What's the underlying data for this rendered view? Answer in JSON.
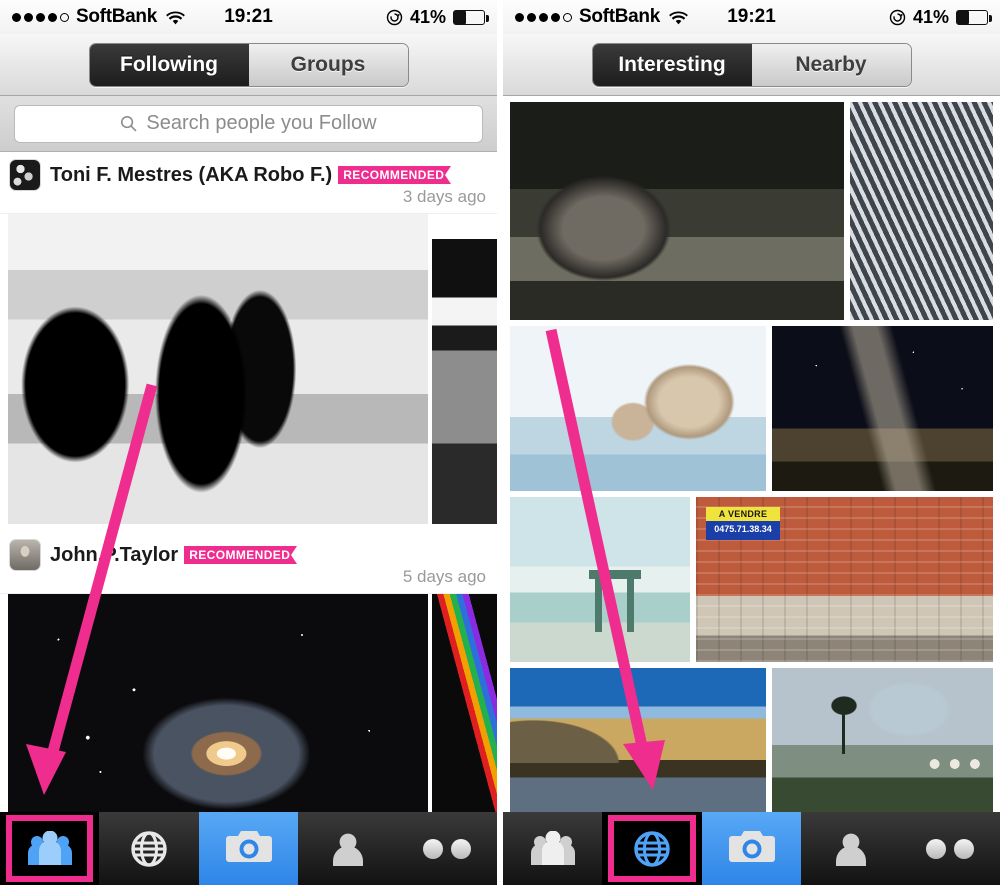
{
  "status_bar": {
    "signal_dots_filled": 4,
    "signal_dots_total": 5,
    "carrier": "SoftBank",
    "wifi_icon": "wifi-icon",
    "time": "19:21",
    "rotation_lock_icon": "rotation-lock-icon",
    "battery_percent": "41%",
    "battery_level": 41
  },
  "left_screen": {
    "segmented_control": {
      "selected": "Following",
      "options": [
        "Following",
        "Groups"
      ]
    },
    "search": {
      "icon": "search-icon",
      "placeholder": "Search people you Follow",
      "value": ""
    },
    "posts": [
      {
        "avatar": "avatar-toni",
        "username": "Toni F. Mestres (AKA Robo F.)",
        "badge": "RECOMMENDED",
        "time": "3 days ago",
        "photos": [
          "bw-street-kiss",
          "bw-passeig-de-gracia-sign"
        ]
      },
      {
        "avatar": "avatar-john",
        "username": "John.P.Taylor",
        "badge": "RECOMMENDED",
        "time": "5 days ago",
        "photos": [
          "spiral-galaxy-m81",
          "color-chart-graph"
        ]
      }
    ],
    "tabbar": {
      "selected": "people",
      "items": [
        {
          "id": "people",
          "icon": "people-group-icon",
          "label": "People"
        },
        {
          "id": "globe",
          "icon": "globe-icon",
          "label": "Explore"
        },
        {
          "id": "camera",
          "icon": "camera-icon",
          "label": "Camera"
        },
        {
          "id": "person",
          "icon": "person-icon",
          "label": "Profile"
        },
        {
          "id": "more",
          "icon": "more-dots-icon",
          "label": "More"
        }
      ]
    }
  },
  "right_screen": {
    "segmented_control": {
      "selected": "Interesting",
      "options": [
        "Interesting",
        "Nearby"
      ]
    },
    "grid_rows": [
      {
        "cells": [
          {
            "id": "bw-stone-barn-landscape",
            "caption": ""
          },
          {
            "id": "bw-glass-tower-architecture",
            "caption": ""
          }
        ]
      },
      {
        "cells": [
          {
            "id": "snow-monkeys-hot-spring",
            "caption": ""
          },
          {
            "id": "milky-way-night-sky",
            "caption": ""
          }
        ]
      },
      {
        "cells": [
          {
            "id": "beach-lifeguard-stand",
            "caption": ""
          },
          {
            "id": "street-musicians-brick-wall",
            "caption": "",
            "sign_line1": "A VENDRE",
            "sign_line2": "0475.71.38.34"
          }
        ]
      },
      {
        "cells": [
          {
            "id": "golden-hills-lake-reflection",
            "caption": ""
          },
          {
            "id": "misty-sheep-landscape",
            "caption": ""
          }
        ]
      }
    ],
    "tabbar": {
      "selected": "globe",
      "items": [
        {
          "id": "people",
          "icon": "people-group-icon",
          "label": "People"
        },
        {
          "id": "globe",
          "icon": "globe-icon",
          "label": "Explore"
        },
        {
          "id": "camera",
          "icon": "camera-icon",
          "label": "Camera"
        },
        {
          "id": "person",
          "icon": "person-icon",
          "label": "Profile"
        },
        {
          "id": "more",
          "icon": "more-dots-icon",
          "label": "More"
        }
      ]
    }
  },
  "annotations": {
    "arrow_color": "#ef2d8f",
    "left_arrow": "points from first photo down to the People tab",
    "right_arrow": "points from the photo grid down to the Globe tab"
  },
  "colors": {
    "accent_pink": "#ef2d8f",
    "camera_blue": "#2f86e8",
    "tabbar_dark": "#121212"
  }
}
